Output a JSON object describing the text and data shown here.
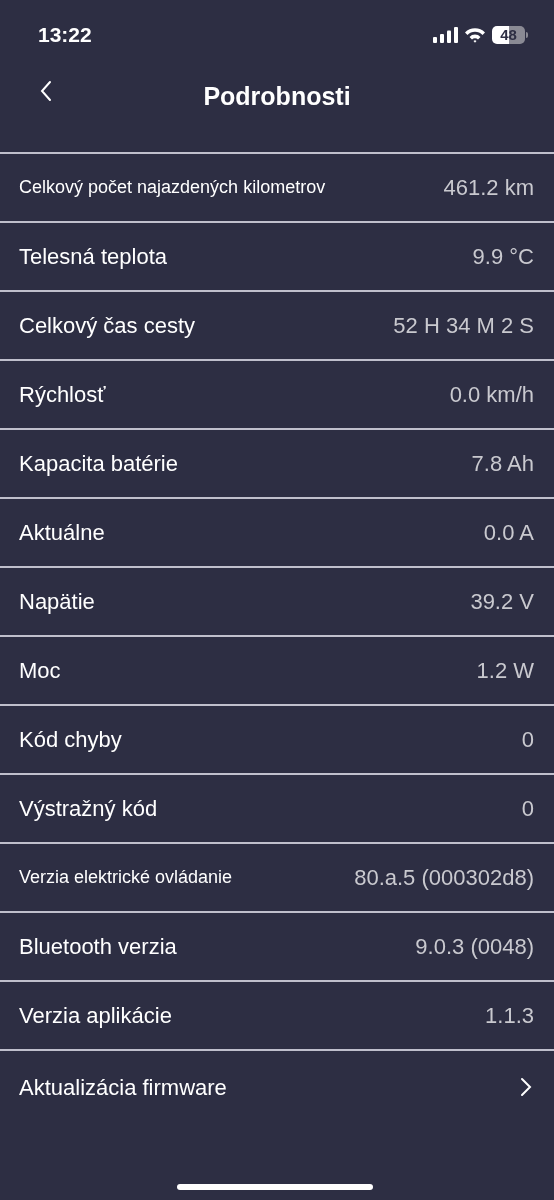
{
  "status_bar": {
    "time": "13:22",
    "battery": "48"
  },
  "nav": {
    "title": "Podrobnosti"
  },
  "rows": [
    {
      "label": "Celkový počet najazdených kilometrov",
      "value": "461.2 km"
    },
    {
      "label": "Telesná teplota",
      "value": "9.9 °C"
    },
    {
      "label": "Celkový čas cesty",
      "value": "52 H 34 M 2 S"
    },
    {
      "label": "Rýchlosť",
      "value": "0.0 km/h"
    },
    {
      "label": "Kapacita batérie",
      "value": "7.8 Ah"
    },
    {
      "label": "Aktuálne",
      "value": "0.0 A"
    },
    {
      "label": "Napätie",
      "value": "39.2 V"
    },
    {
      "label": "Moc",
      "value": "1.2 W"
    },
    {
      "label": "Kód chyby",
      "value": "0"
    },
    {
      "label": "Výstražný kód",
      "value": "0"
    },
    {
      "label": "Verzia elektrické ovládanie",
      "value": "80.a.5 (000302d8)"
    },
    {
      "label": "Bluetooth verzia",
      "value": "9.0.3 (0048)"
    },
    {
      "label": "Verzia aplikácie",
      "value": "1.1.3"
    }
  ],
  "firmware": {
    "label": "Aktualizácia firmware"
  }
}
